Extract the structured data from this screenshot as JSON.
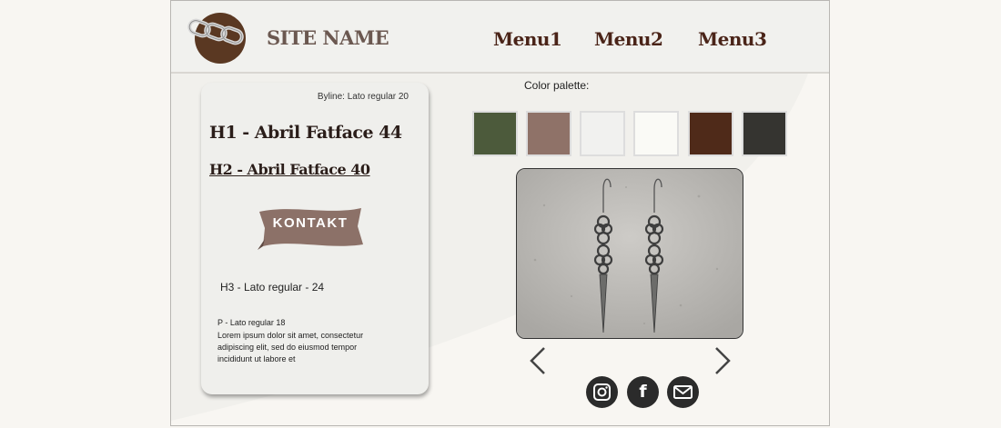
{
  "header": {
    "site_name": "SITE NAME",
    "logo_icon": "chain-link-icon",
    "nav": [
      "Menu1",
      "Menu2",
      "Menu3"
    ]
  },
  "card": {
    "byline": "Byline: Lato regular 20",
    "h1": "H1 - Abril Fatface 44",
    "h2": "H2 - Abril Fatface 40",
    "button_label": "KONTAKT",
    "h3": "H3 - Lato regular - 24",
    "p_title": "P - Lato regular 18",
    "p_body": " Lorem ipsum dolor sit amet, consectetur adipiscing elit, sed do eiusmod tempor incididunt ut labore et"
  },
  "palette": {
    "label": "Color palette:",
    "colors": [
      "#4c5a3b",
      "#8f7268",
      "#f1f1ef",
      "#fafaf6",
      "#4f2a19",
      "#353430"
    ]
  },
  "carousel": {
    "prev_icon": "chevron-left-icon",
    "next_icon": "chevron-right-icon"
  },
  "social": {
    "icons": [
      "instagram-icon",
      "facebook-icon",
      "mail-icon"
    ],
    "facebook_glyph": "f"
  }
}
